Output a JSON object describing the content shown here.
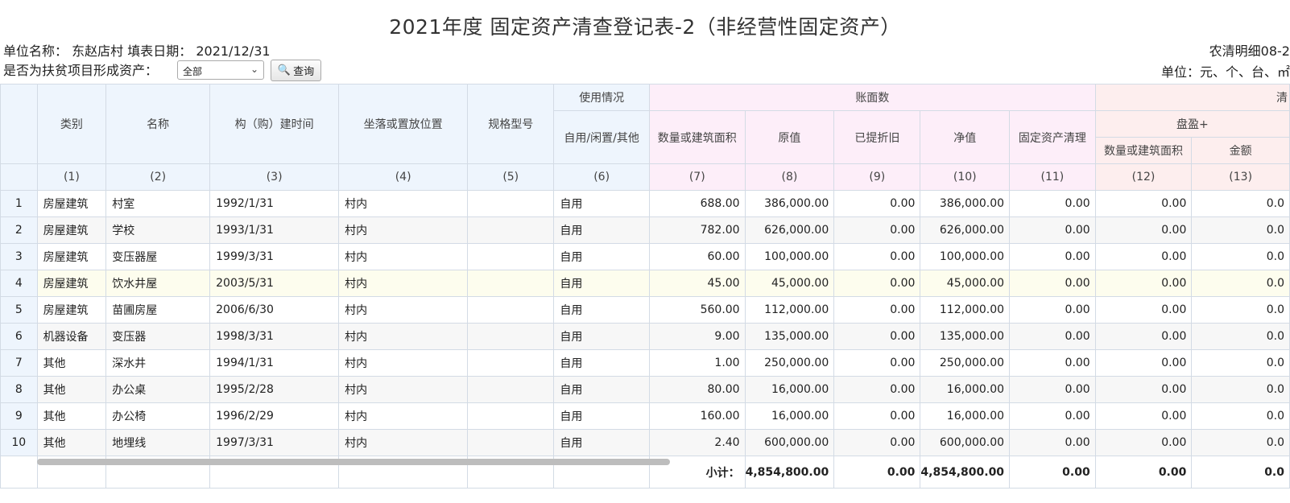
{
  "title": "2021年度 固定资产清查登记表-2（非经营性固定资产）",
  "unit_label": "单位名称：",
  "unit_name": "东赵店村",
  "fill_date_label": "填表日期：",
  "fill_date": "2021/12/31",
  "form_code": "农清明细08-2",
  "unit_measure": "单位：元、个、台、㎡",
  "filter": {
    "label": "是否为扶贫项目形成资产：",
    "selected": "全部",
    "query_label": "查询"
  },
  "header": {
    "category": "类别",
    "name": "名称",
    "build_time": "构（购）建时间",
    "location": "坐落或置放位置",
    "spec": "规格型号",
    "usage_group": "使用情况",
    "usage": "自用/闲置/其他",
    "book_group": "账面数",
    "qty": "数量或建筑面积",
    "original": "原值",
    "depreciation": "已提折旧",
    "net": "净值",
    "cleanup": "固定资产清理",
    "check_group": "清",
    "surplus_group": "盘盈+",
    "surplus_qty": "数量或建筑面积",
    "surplus_amount": "金额",
    "col_nums": [
      "(1)",
      "(2)",
      "(3)",
      "(4)",
      "(5)",
      "(6)",
      "(7)",
      "(8)",
      "(9)",
      "(10)",
      "(11)",
      "(12)",
      "(13)"
    ]
  },
  "rows": [
    {
      "no": "1",
      "category": "房屋建筑",
      "name": "村室",
      "time": "1992/1/31",
      "location": "村内",
      "spec": "",
      "usage": "自用",
      "qty": "688.00",
      "original": "386,000.00",
      "dep": "0.00",
      "net": "386,000.00",
      "cleanup": "0.00",
      "s_qty": "0.00",
      "s_amt": "0.0"
    },
    {
      "no": "2",
      "category": "房屋建筑",
      "name": "学校",
      "time": "1993/1/31",
      "location": "村内",
      "spec": "",
      "usage": "自用",
      "qty": "782.00",
      "original": "626,000.00",
      "dep": "0.00",
      "net": "626,000.00",
      "cleanup": "0.00",
      "s_qty": "0.00",
      "s_amt": "0.0"
    },
    {
      "no": "3",
      "category": "房屋建筑",
      "name": "变压器屋",
      "time": "1999/3/31",
      "location": "村内",
      "spec": "",
      "usage": "自用",
      "qty": "60.00",
      "original": "100,000.00",
      "dep": "0.00",
      "net": "100,000.00",
      "cleanup": "0.00",
      "s_qty": "0.00",
      "s_amt": "0.0"
    },
    {
      "no": "4",
      "category": "房屋建筑",
      "name": "饮水井屋",
      "time": "2003/5/31",
      "location": "村内",
      "spec": "",
      "usage": "自用",
      "qty": "45.00",
      "original": "45,000.00",
      "dep": "0.00",
      "net": "45,000.00",
      "cleanup": "0.00",
      "s_qty": "0.00",
      "s_amt": "0.0"
    },
    {
      "no": "5",
      "category": "房屋建筑",
      "name": "苗圃房屋",
      "time": "2006/6/30",
      "location": "村内",
      "spec": "",
      "usage": "自用",
      "qty": "560.00",
      "original": "112,000.00",
      "dep": "0.00",
      "net": "112,000.00",
      "cleanup": "0.00",
      "s_qty": "0.00",
      "s_amt": "0.0"
    },
    {
      "no": "6",
      "category": "机器设备",
      "name": "变压器",
      "time": "1998/3/31",
      "location": "村内",
      "spec": "",
      "usage": "自用",
      "qty": "9.00",
      "original": "135,000.00",
      "dep": "0.00",
      "net": "135,000.00",
      "cleanup": "0.00",
      "s_qty": "0.00",
      "s_amt": "0.0"
    },
    {
      "no": "7",
      "category": "其他",
      "name": "深水井",
      "time": "1994/1/31",
      "location": "村内",
      "spec": "",
      "usage": "自用",
      "qty": "1.00",
      "original": "250,000.00",
      "dep": "0.00",
      "net": "250,000.00",
      "cleanup": "0.00",
      "s_qty": "0.00",
      "s_amt": "0.0"
    },
    {
      "no": "8",
      "category": "其他",
      "name": "办公桌",
      "time": "1995/2/28",
      "location": "村内",
      "spec": "",
      "usage": "自用",
      "qty": "80.00",
      "original": "16,000.00",
      "dep": "0.00",
      "net": "16,000.00",
      "cleanup": "0.00",
      "s_qty": "0.00",
      "s_amt": "0.0"
    },
    {
      "no": "9",
      "category": "其他",
      "name": "办公椅",
      "time": "1996/2/29",
      "location": "村内",
      "spec": "",
      "usage": "自用",
      "qty": "160.00",
      "original": "16,000.00",
      "dep": "0.00",
      "net": "16,000.00",
      "cleanup": "0.00",
      "s_qty": "0.00",
      "s_amt": "0.0"
    },
    {
      "no": "10",
      "category": "其他",
      "name": "地埋线",
      "time": "1997/3/31",
      "location": "村内",
      "spec": "",
      "usage": "自用",
      "qty": "2.40",
      "original": "600,000.00",
      "dep": "0.00",
      "net": "600,000.00",
      "cleanup": "0.00",
      "s_qty": "0.00",
      "s_amt": "0.0"
    }
  ],
  "totals": {
    "label": "小计：",
    "original": "4,854,800.00",
    "dep": "0.00",
    "net": "4,854,800.00",
    "cleanup": "0.00",
    "s_qty": "0.00",
    "s_amt": "0.0"
  },
  "colors": {
    "header_blue": "#eef5fd",
    "header_pink": "#fdeef9",
    "header_red": "#fdeeee"
  }
}
